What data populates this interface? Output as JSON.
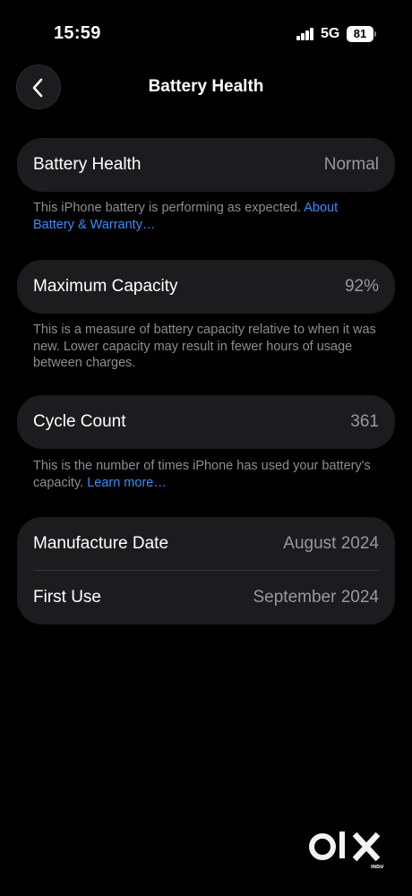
{
  "status_bar": {
    "time": "15:59",
    "network": "5G",
    "battery_level": "81"
  },
  "nav": {
    "title": "Battery Health"
  },
  "battery_health": {
    "label": "Battery Health",
    "value": "Normal",
    "description": "This iPhone battery is performing as expected.",
    "link": "About Battery & Warranty…"
  },
  "max_capacity": {
    "label": "Maximum Capacity",
    "value": "92%",
    "description": "This is a measure of battery capacity relative to when it was new. Lower capacity may result in fewer hours of usage between charges."
  },
  "cycle_count": {
    "label": "Cycle Count",
    "value": "361",
    "description": "This is the number of times iPhone has used your battery's capacity.",
    "link": "Learn more…"
  },
  "dates": {
    "manufacture_label": "Manufacture Date",
    "manufacture_value": "August 2024",
    "first_use_label": "First Use",
    "first_use_value": "September 2024"
  },
  "watermark": {
    "brand": "OLX",
    "sub": "INDIA"
  }
}
